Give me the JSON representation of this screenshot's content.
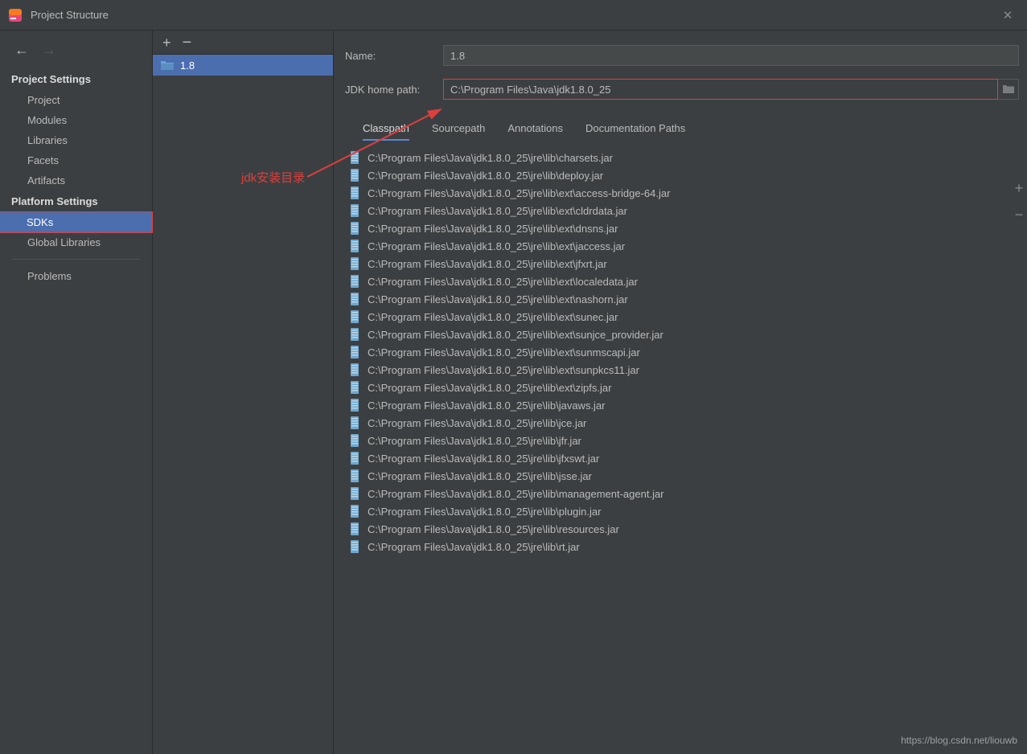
{
  "window": {
    "title": "Project Structure"
  },
  "sidebar": {
    "projectSettingsHeading": "Project Settings",
    "projectItems": [
      "Project",
      "Modules",
      "Libraries",
      "Facets",
      "Artifacts"
    ],
    "platformSettingsHeading": "Platform Settings",
    "platformItems": [
      "SDKs",
      "Global Libraries"
    ],
    "problems": "Problems",
    "selected": "SDKs"
  },
  "sdkList": {
    "items": [
      "1.8"
    ]
  },
  "form": {
    "nameLabel": "Name:",
    "nameValue": "1.8",
    "jdkPathLabel": "JDK home path:",
    "jdkPathValue": "C:\\Program Files\\Java\\jdk1.8.0_25"
  },
  "tabs": {
    "items": [
      "Classpath",
      "Sourcepath",
      "Annotations",
      "Documentation Paths"
    ],
    "active": "Classpath"
  },
  "classpath": [
    "C:\\Program Files\\Java\\jdk1.8.0_25\\jre\\lib\\charsets.jar",
    "C:\\Program Files\\Java\\jdk1.8.0_25\\jre\\lib\\deploy.jar",
    "C:\\Program Files\\Java\\jdk1.8.0_25\\jre\\lib\\ext\\access-bridge-64.jar",
    "C:\\Program Files\\Java\\jdk1.8.0_25\\jre\\lib\\ext\\cldrdata.jar",
    "C:\\Program Files\\Java\\jdk1.8.0_25\\jre\\lib\\ext\\dnsns.jar",
    "C:\\Program Files\\Java\\jdk1.8.0_25\\jre\\lib\\ext\\jaccess.jar",
    "C:\\Program Files\\Java\\jdk1.8.0_25\\jre\\lib\\ext\\jfxrt.jar",
    "C:\\Program Files\\Java\\jdk1.8.0_25\\jre\\lib\\ext\\localedata.jar",
    "C:\\Program Files\\Java\\jdk1.8.0_25\\jre\\lib\\ext\\nashorn.jar",
    "C:\\Program Files\\Java\\jdk1.8.0_25\\jre\\lib\\ext\\sunec.jar",
    "C:\\Program Files\\Java\\jdk1.8.0_25\\jre\\lib\\ext\\sunjce_provider.jar",
    "C:\\Program Files\\Java\\jdk1.8.0_25\\jre\\lib\\ext\\sunmscapi.jar",
    "C:\\Program Files\\Java\\jdk1.8.0_25\\jre\\lib\\ext\\sunpkcs11.jar",
    "C:\\Program Files\\Java\\jdk1.8.0_25\\jre\\lib\\ext\\zipfs.jar",
    "C:\\Program Files\\Java\\jdk1.8.0_25\\jre\\lib\\javaws.jar",
    "C:\\Program Files\\Java\\jdk1.8.0_25\\jre\\lib\\jce.jar",
    "C:\\Program Files\\Java\\jdk1.8.0_25\\jre\\lib\\jfr.jar",
    "C:\\Program Files\\Java\\jdk1.8.0_25\\jre\\lib\\jfxswt.jar",
    "C:\\Program Files\\Java\\jdk1.8.0_25\\jre\\lib\\jsse.jar",
    "C:\\Program Files\\Java\\jdk1.8.0_25\\jre\\lib\\management-agent.jar",
    "C:\\Program Files\\Java\\jdk1.8.0_25\\jre\\lib\\plugin.jar",
    "C:\\Program Files\\Java\\jdk1.8.0_25\\jre\\lib\\resources.jar",
    "C:\\Program Files\\Java\\jdk1.8.0_25\\jre\\lib\\rt.jar"
  ],
  "annotation": {
    "text": "jdk安装目录"
  },
  "watermark": "https://blog.csdn.net/liouwb"
}
